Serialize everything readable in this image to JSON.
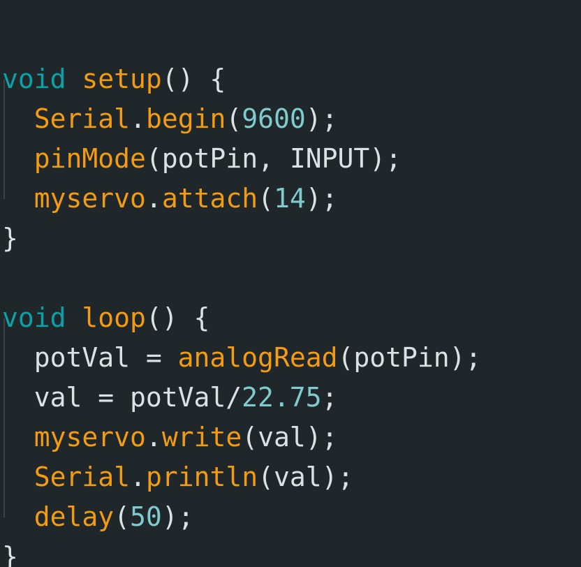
{
  "editor": {
    "colors": {
      "background": "#1f272a",
      "keyword": "#0ca1a6",
      "function": "#f39c12",
      "number": "#7fcbcd",
      "text": "#dae3e3"
    },
    "lines": [
      [],
      [
        {
          "t": "void",
          "c": "kw"
        },
        {
          "t": " ",
          "c": "pn"
        },
        {
          "t": "setup",
          "c": "fn"
        },
        {
          "t": "() {",
          "c": "pn"
        }
      ],
      [
        {
          "t": "  ",
          "c": "pn"
        },
        {
          "t": "Serial",
          "c": "fn"
        },
        {
          "t": ".",
          "c": "pn"
        },
        {
          "t": "begin",
          "c": "fn"
        },
        {
          "t": "(",
          "c": "pn"
        },
        {
          "t": "9600",
          "c": "num"
        },
        {
          "t": ");",
          "c": "pn"
        }
      ],
      [
        {
          "t": "  ",
          "c": "pn"
        },
        {
          "t": "pinMode",
          "c": "fn"
        },
        {
          "t": "(potPin, INPUT);",
          "c": "id"
        }
      ],
      [
        {
          "t": "  ",
          "c": "pn"
        },
        {
          "t": "myservo",
          "c": "fn"
        },
        {
          "t": ".",
          "c": "pn"
        },
        {
          "t": "attach",
          "c": "fn"
        },
        {
          "t": "(",
          "c": "pn"
        },
        {
          "t": "14",
          "c": "num"
        },
        {
          "t": ");",
          "c": "pn"
        }
      ],
      [
        {
          "t": "}",
          "c": "pn"
        }
      ],
      [],
      [
        {
          "t": "void",
          "c": "kw"
        },
        {
          "t": " ",
          "c": "pn"
        },
        {
          "t": "loop",
          "c": "fn"
        },
        {
          "t": "() {",
          "c": "pn"
        }
      ],
      [
        {
          "t": "  potVal = ",
          "c": "id"
        },
        {
          "t": "analogRead",
          "c": "fn"
        },
        {
          "t": "(potPin);",
          "c": "id"
        }
      ],
      [
        {
          "t": "  val = potVal/",
          "c": "id"
        },
        {
          "t": "22.75",
          "c": "num"
        },
        {
          "t": ";",
          "c": "pn"
        }
      ],
      [
        {
          "t": "  ",
          "c": "pn"
        },
        {
          "t": "myservo",
          "c": "fn"
        },
        {
          "t": ".",
          "c": "pn"
        },
        {
          "t": "write",
          "c": "fn"
        },
        {
          "t": "(val);",
          "c": "id"
        }
      ],
      [
        {
          "t": "  ",
          "c": "pn"
        },
        {
          "t": "Serial",
          "c": "fn"
        },
        {
          "t": ".",
          "c": "pn"
        },
        {
          "t": "println",
          "c": "fn"
        },
        {
          "t": "(val);",
          "c": "id"
        }
      ],
      [
        {
          "t": "  ",
          "c": "pn"
        },
        {
          "t": "delay",
          "c": "fn"
        },
        {
          "t": "(",
          "c": "pn"
        },
        {
          "t": "50",
          "c": "num"
        },
        {
          "t": ");",
          "c": "pn"
        }
      ],
      [
        {
          "t": "}",
          "c": "pn"
        }
      ]
    ]
  }
}
